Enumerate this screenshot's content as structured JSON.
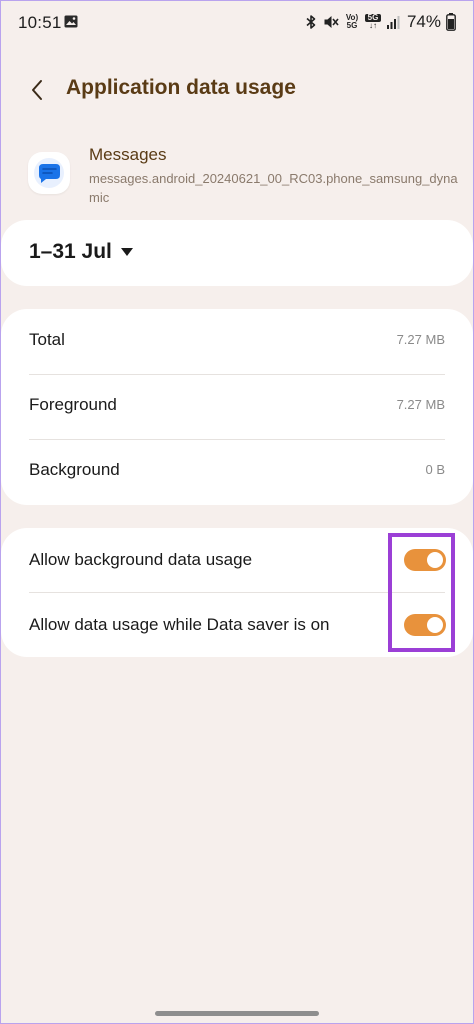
{
  "status_bar": {
    "time": "10:51",
    "network_badge_top": "Vo)",
    "network_badge_bottom": "5G",
    "network_badge2_top": "5G",
    "battery": "74%",
    "icons": [
      "gallery-icon",
      "bluetooth-icon",
      "mute-icon",
      "volte-icon",
      "5g-icon",
      "signal-icon",
      "battery-icon"
    ]
  },
  "header": {
    "title": "Application data usage",
    "back_icon": "chevron-left-icon"
  },
  "app": {
    "name": "Messages",
    "package": "messages.android_20240621_00_RC03.phone_samsung_dynamic",
    "icon": "messages-app-icon"
  },
  "date_range": {
    "label": "1–31 Jul",
    "icon": "dropdown-triangle-icon"
  },
  "usage": {
    "rows": [
      {
        "label": "Total",
        "value": "7.27 MB"
      },
      {
        "label": "Foreground",
        "value": "7.27 MB"
      },
      {
        "label": "Background",
        "value": "0 B"
      }
    ]
  },
  "settings": {
    "rows": [
      {
        "label": "Allow background data usage",
        "enabled": true
      },
      {
        "label": "Allow data usage while Data saver is on",
        "enabled": true
      }
    ]
  },
  "colors": {
    "background": "#f6efec",
    "card": "#ffffff",
    "title": "#5a3b15",
    "toggle_on": "#e8923c",
    "highlight": "#9b3fd6",
    "messages_blue": "#1a73e8"
  }
}
